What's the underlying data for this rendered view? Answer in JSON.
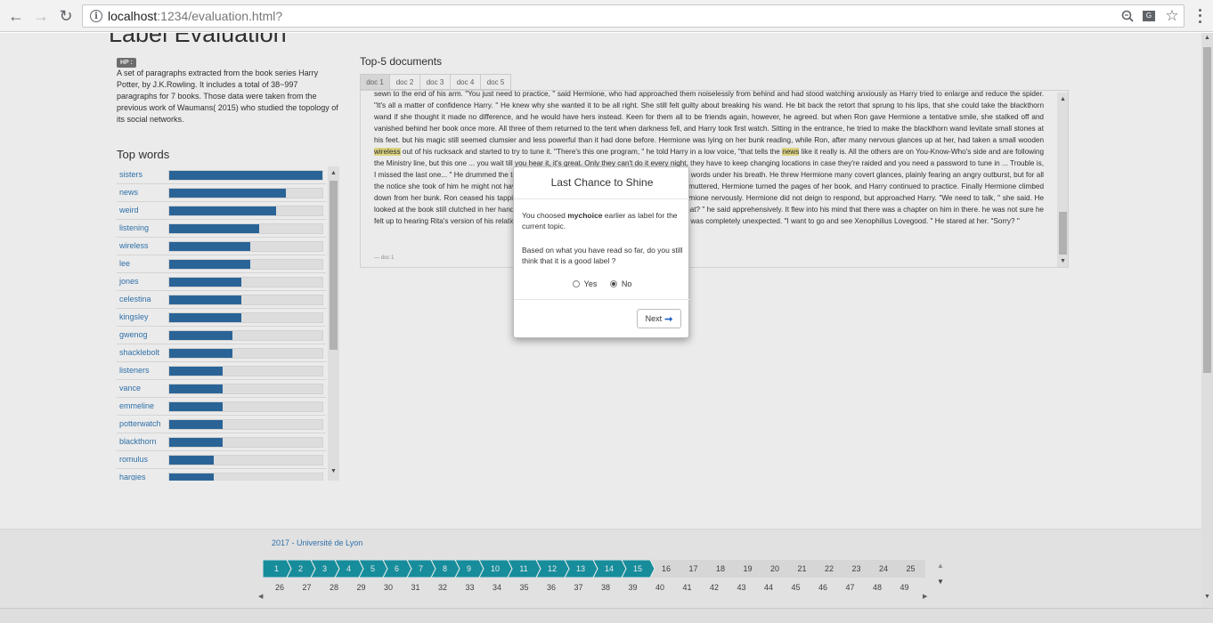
{
  "browser": {
    "url_host": "localhost",
    "url_rest": ":1234/evaluation.html?"
  },
  "page": {
    "title": "Label Evaluation",
    "hp_badge": "HP :",
    "description": "A set of paragraphs extracted from the book series Harry Potter, by J.K.Rowling. It includes a total of 38~997 paragraphs for 7 books. Those data were taken from the previous work of Waumans( 2015) who studied the topology of its social networks.",
    "top_words_title": "Top words",
    "top_words": [
      {
        "word": "sisters",
        "level": 1.0
      },
      {
        "word": "news",
        "level": 0.76
      },
      {
        "word": "weird",
        "level": 0.7
      },
      {
        "word": "listening",
        "level": 0.59
      },
      {
        "word": "wireless",
        "level": 0.53
      },
      {
        "word": "lee",
        "level": 0.53
      },
      {
        "word": "jones",
        "level": 0.47
      },
      {
        "word": "celestina",
        "level": 0.47
      },
      {
        "word": "kingsley",
        "level": 0.47
      },
      {
        "word": "gwenog",
        "level": 0.41
      },
      {
        "word": "shacklebolt",
        "level": 0.41
      },
      {
        "word": "listeners",
        "level": 0.35
      },
      {
        "word": "vance",
        "level": 0.35
      },
      {
        "word": "emmeline",
        "level": 0.35
      },
      {
        "word": "potterwatch",
        "level": 0.35
      },
      {
        "word": "blackthorn",
        "level": 0.35
      },
      {
        "word": "romulus",
        "level": 0.29
      },
      {
        "word": "hargies",
        "level": 0.29
      }
    ],
    "top5_title": "Top-5 documents",
    "doc_tabs": [
      "doc 1",
      "doc 2",
      "doc 3",
      "doc 4",
      "doc 5"
    ],
    "doc_segments": [
      {
        "t": "sewn to the end of his arm. \"You just need to practice, \" said Hermione, who had approached them noiselessly from behind and had stood watching anxiously as Harry tried to enlarge and reduce the spider. \"It's all a matter of confidence Harry. \" He knew why she wanted it to be all right. She still felt guilty about breaking his wand. He bit back the retort that sprung to his lips, that she could take the blackthorn wand if she thought it made no difference, and he would have hers instead. Keen for them all to be friends again, however, he agreed. but when Ron gave Hermione a tentative smile, she stalked off and vanished behind her book once more. All three of them returned to the tent when darkness fell, and Harry took first watch. Sitting in the entrance, he tried to make the blackthorn wand levitate small stones at his feet. but his magic still seemed clumsier and less powerful than it had done before. Hermione was lying on her bunk reading, while Ron, after many nervous glances up at her, had taken a small wooden ",
        "h": false
      },
      {
        "t": "wireless",
        "h": true
      },
      {
        "t": " out of his rucksack and started to try to tune it. \"There's this one program, \" he told Harry in a low voice, \"that tells the ",
        "h": false
      },
      {
        "t": "news",
        "h": true
      },
      {
        "t": " like it really is. All the others are on You-Know-Who's side and are following the Ministry line, but this one ... you wait till you hear it, it's great. Only they can't do it every night, they have to keep changing locations in case they're raided and you need a password to tune in ... Trouble is, I missed the last one... \" He drummed the top of the wireless with his wand and muttering random words under his breath. He threw Hermione many covert glances, plainly fearing an angry outburst, but for all the notice she took of him he might not have been there. For ten minutes or so Ron tapped and muttered, Hermione turned the pages of her book, and Harry continued to practice. Finally Hermione climbed down from her bunk. Ron ceased his tapping at once. \"If it's annoying you, I'll stop! \" he told Hermione nervously. Hermione did not deign to respond, but approached Harry. \"We need to talk, \" she said. He looked at the book still clutched in her hand. It was \" The Life and Lies of Albus Dumbledore.\" \"What? \" he said apprehensively. It flew into his mind that there was a chapter on him in there. he was not sure he felt up to hearing Rita's version of his relationship with Dumbledore. Hermione's answer, however, was completely unexpected. \"I want to go and see Xenophilius Lovegood. \" He stared at her. \"Sorry? \"",
        "h": false
      }
    ],
    "doc_footer": "— doc 1"
  },
  "footer": {
    "text": "2017 - Université de Lyon",
    "pages_row1": [
      "1",
      "2",
      "3",
      "4",
      "5",
      "6",
      "7",
      "8",
      "9",
      "10",
      "11",
      "12",
      "13",
      "14",
      "15",
      "16",
      "17",
      "18",
      "19",
      "20",
      "21",
      "22",
      "23",
      "24",
      "25"
    ],
    "pages_done_count": 15,
    "pages_row2": [
      "26",
      "27",
      "28",
      "29",
      "30",
      "31",
      "32",
      "33",
      "34",
      "35",
      "36",
      "37",
      "38",
      "39",
      "40",
      "41",
      "42",
      "43",
      "44",
      "45",
      "46",
      "47",
      "48",
      "49"
    ]
  },
  "modal": {
    "title": "Last Chance to Shine",
    "msg_prefix": "You choosed ",
    "choice": "mychoice",
    "msg_suffix": " earlier as label for the current topic.",
    "question": "Based on what you have read so far, do you still think that it is a good label ?",
    "yes_label": "Yes",
    "no_label": "No",
    "selected": "No",
    "next_label": "Next"
  },
  "colors": {
    "bar": "#2e6da4",
    "pager_done": "#1a99aa",
    "link": "#337ab7"
  }
}
